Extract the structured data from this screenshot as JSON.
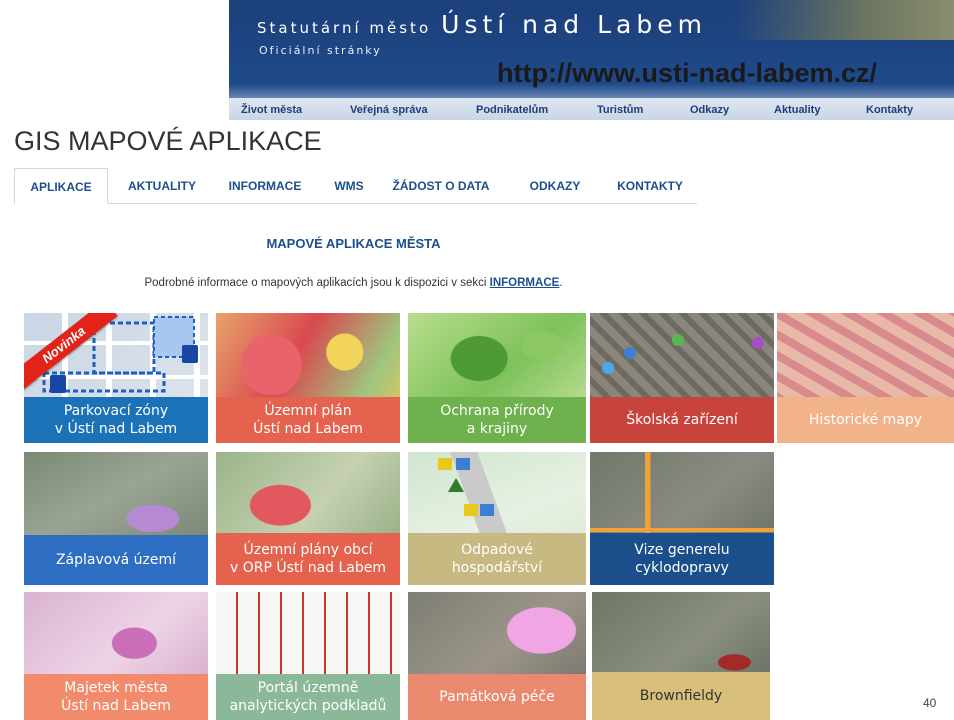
{
  "banner": {
    "title_small": "Statutární město",
    "title_big": "Ústí nad Labem",
    "subtitle": "Oficiální stránky",
    "url": "http://www.usti-nad-labem.cz/",
    "menu": [
      "Život města",
      "Veřejná správa",
      "Podnikatelům",
      "Turistům",
      "Odkazy",
      "Aktuality",
      "Kontakty"
    ]
  },
  "gis": {
    "title": "GIS MAPOVÉ APLIKACE",
    "tabs": [
      "APLIKACE",
      "AKTUALITY",
      "INFORMACE",
      "WMS",
      "ŽÁDOST O DATA",
      "ODKAZY",
      "KONTAKTY"
    ],
    "active_tab": "APLIKACE",
    "heading": "MAPOVÉ APLIKACE MĚSTA",
    "info_text": "Podrobné informace o mapových aplikacích jsou k dispozici v sekci ",
    "info_link": "INFORMACE",
    "info_end": "."
  },
  "tiles": [
    {
      "line1": "Parkovací zóny",
      "line2": "v Ústí nad Labem",
      "badge": "Novinka"
    },
    {
      "line1": "Územní plán",
      "line2": "Ústí nad Labem"
    },
    {
      "line1": "Ochrana přírody",
      "line2": "a krajiny"
    },
    {
      "line1": "Školská zařízení",
      "line2": ""
    },
    {
      "line1": "Historické mapy",
      "line2": ""
    },
    {
      "line1": "Záplavová území",
      "line2": ""
    },
    {
      "line1": "Územní plány obcí",
      "line2": "v ORP Ústí nad Labem"
    },
    {
      "line1": "Odpadové",
      "line2": "hospodářství"
    },
    {
      "line1": "Vize generelu",
      "line2": "cyklodopravy"
    },
    {
      "line1": "Majetek města",
      "line2": "Ústí nad Labem"
    },
    {
      "line1": "Portál územně",
      "line2": "analytických podkladů"
    },
    {
      "line1": "Památková péče",
      "line2": ""
    },
    {
      "line1": "Brownfieldy",
      "line2": ""
    }
  ],
  "page_number": "40",
  "colors": {
    "brand_blue": "#1c4f8c",
    "banner_blue": "#1f4a8a",
    "badge_red": "#e2231a"
  }
}
